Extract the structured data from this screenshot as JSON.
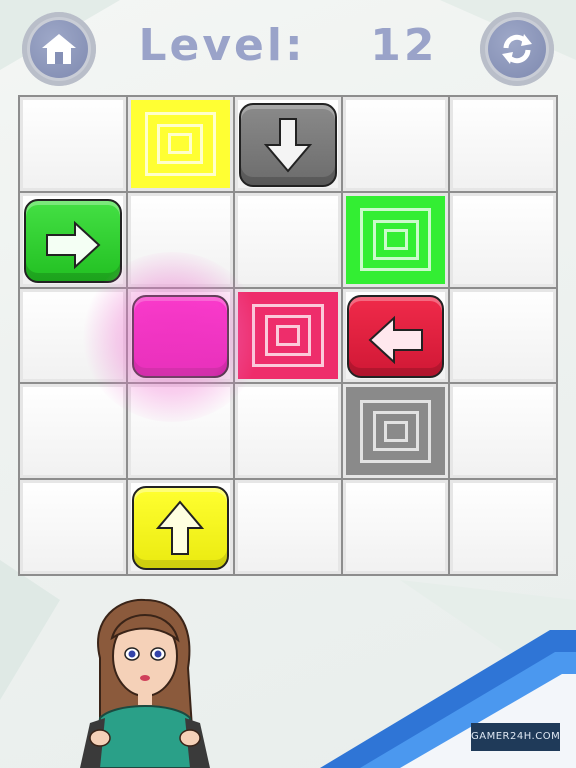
{
  "header": {
    "level_label": "Level:",
    "level_number": "12",
    "home_icon": "home-icon",
    "restart_icon": "restart-icon"
  },
  "board": {
    "rows": 5,
    "cols": 5,
    "targets": [
      {
        "row": 0,
        "col": 1,
        "color": "yellow"
      },
      {
        "row": 1,
        "col": 3,
        "color": "green"
      },
      {
        "row": 2,
        "col": 2,
        "color": "red"
      },
      {
        "row": 3,
        "col": 3,
        "color": "gray"
      }
    ],
    "blocks": [
      {
        "row": 0,
        "col": 2,
        "color": "gray",
        "arrow": "down"
      },
      {
        "row": 1,
        "col": 0,
        "color": "green",
        "arrow": "right"
      },
      {
        "row": 2,
        "col": 1,
        "color": "magenta",
        "arrow": "none",
        "selected": true
      },
      {
        "row": 2,
        "col": 3,
        "color": "red",
        "arrow": "left"
      },
      {
        "row": 4,
        "col": 1,
        "color": "yellow",
        "arrow": "up"
      }
    ]
  },
  "colors": {
    "yellow": "#ffff33",
    "green": "#33ee33",
    "red": "#ee2d6b",
    "gray": "#8a8a8a",
    "magenta": "#ff1ac8",
    "level_text": "#9aa3c9"
  },
  "watermark": "GAMER24H.COM"
}
